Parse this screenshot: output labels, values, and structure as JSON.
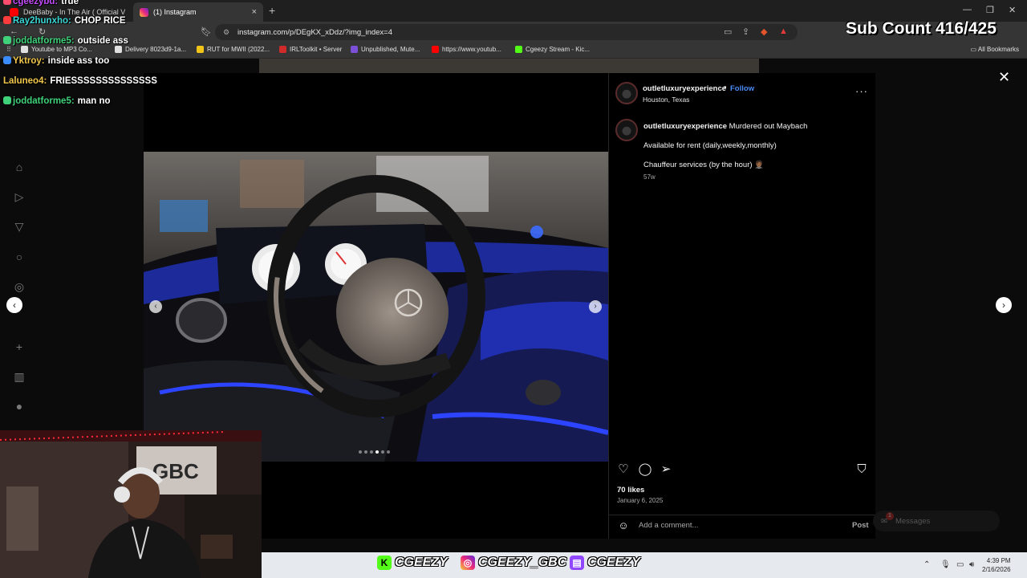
{
  "browser": {
    "tabs": [
      {
        "title": "DeeBaby - In The Air ( Official Video",
        "active": false
      },
      {
        "title": "(1) Instagram",
        "active": true
      }
    ],
    "url": "instagram.com/p/DEgKX_xDdz/?img_index=4",
    "bookmarks": [
      "Youtube to MP3 Co...",
      "Delivery 8023d9-1a...",
      "RUT for MWII (2022...",
      "IRLToolkit • Server",
      "Unpublished, Mute...",
      "https://www.youtub...",
      "Cgeezy Stream - Kic..."
    ],
    "all_bookmarks": "All Bookmarks"
  },
  "post": {
    "username": "outletluxuryexperience",
    "follow_label": "Follow",
    "location": "Houston, Texas",
    "caption_user": "outletluxuryexperience",
    "caption_text": "Murdered out Maybach",
    "caption_line2": "Available for rent (daily,weekly,monthly)",
    "caption_line3": "Chauffeur services (by the hour) 🤵🏾",
    "caption_age": "57w",
    "likes": "70 likes",
    "date": "January 6, 2025",
    "comment_placeholder": "Add a comment...",
    "post_label": "Post",
    "carousel_total": 6,
    "carousel_current": 4
  },
  "messages": {
    "label": "Messages",
    "badge": "1"
  },
  "chat": [
    {
      "user": "cgeezybd:",
      "text": "true"
    },
    {
      "user": "Ray2hunxho:",
      "text": "CHOP RICE"
    },
    {
      "user": "joddatforme5:",
      "text": "outside ass"
    },
    {
      "user": "Yktroy:",
      "text": "inside ass too"
    },
    {
      "user": "Laluneo4:",
      "text": "FRIESSSSSSSSSSSSSS"
    },
    {
      "user": "joddatforme5:",
      "text": "man no"
    }
  ],
  "stream": {
    "sub_count": "Sub Count 416/425",
    "socials": [
      "CGEEZY",
      "CGEEZY_GBC",
      "CGEEZY"
    ]
  },
  "taskbar": {
    "time": "4:39 PM",
    "date": "2/16/2026"
  },
  "colors": {
    "accent": "#4a8cf7",
    "panel_bg": "#000000",
    "kick": "#53fc18",
    "twitch": "#9146ff"
  }
}
